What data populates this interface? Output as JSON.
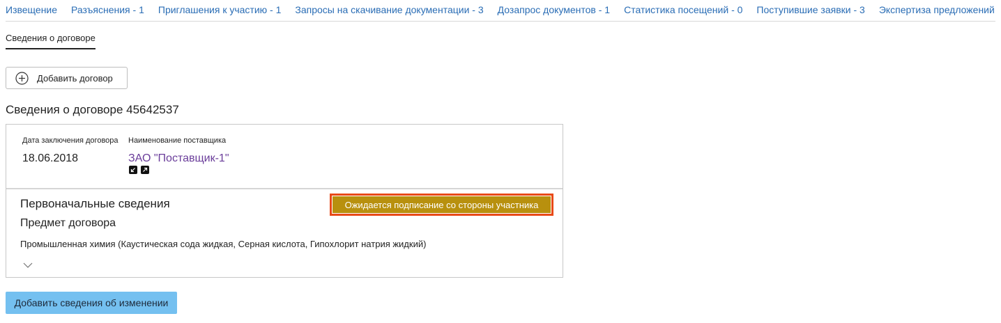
{
  "nav": {
    "tabs": [
      {
        "label": "Извещение"
      },
      {
        "label": "Разъяснения - 1"
      },
      {
        "label": "Приглашения к участию - 1"
      },
      {
        "label": "Запросы на скачивание документации - 3"
      },
      {
        "label": "Дозапрос документов - 1"
      },
      {
        "label": "Статистика посещений - 0"
      },
      {
        "label": "Поступившие заявки - 3"
      },
      {
        "label": "Экспертиза предложений"
      }
    ]
  },
  "subtab": {
    "label": "Сведения о договоре"
  },
  "actions": {
    "add_contract": "Добавить договор",
    "add_changes": "Добавить сведения об изменении"
  },
  "contract": {
    "title": "Сведения о договоре 45642537",
    "date_label": "Дата заключения договора",
    "date_value": "18.06.2018",
    "supplier_label": "Наименование поставщика",
    "supplier_name": "ЗАО \"Поставщик-1\"",
    "initial_title": "Первоначальные сведения",
    "status": "Ожидается подписание со стороны участника",
    "subject_title": "Предмет договора",
    "subject_text": "Промышленная химия (Каустическая сода жидкая, Серная кислота, Гипохлорит натрия жидкий)"
  },
  "icons": {
    "add": "plus-circle-icon",
    "edit": "edit-arrow-icon",
    "external": "external-link-icon",
    "expand": "chevron-down-icon"
  },
  "colors": {
    "link": "#2a6db5",
    "supplier_link": "#6a3d9a",
    "status_bg": "#b8900e",
    "status_border": "#e84a18",
    "primary_button": "#74c0f0"
  }
}
